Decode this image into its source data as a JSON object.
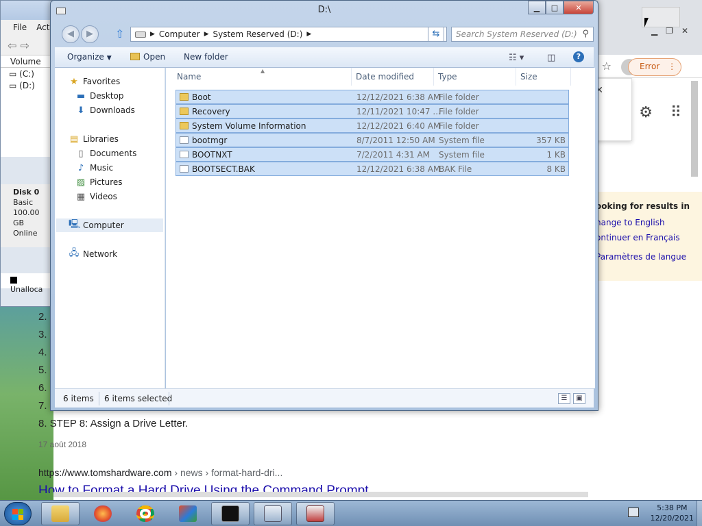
{
  "explorer": {
    "title": "D:\\",
    "breadcrumb": [
      "Computer",
      "System Reserved (D:)"
    ],
    "search_placeholder": "Search System Reserved (D:)",
    "toolbar": {
      "organize": "Organize",
      "open": "Open",
      "new_folder": "New folder"
    },
    "nav": {
      "favorites": "Favorites",
      "desktop": "Desktop",
      "downloads": "Downloads",
      "libraries": "Libraries",
      "documents": "Documents",
      "music": "Music",
      "pictures": "Pictures",
      "videos": "Videos",
      "computer": "Computer",
      "network": "Network"
    },
    "columns": {
      "name": "Name",
      "date": "Date modified",
      "type": "Type",
      "size": "Size"
    },
    "files": [
      {
        "name": "Boot",
        "date": "12/12/2021 6:38 AM",
        "type": "File folder",
        "size": "",
        "icon": "folder-icon"
      },
      {
        "name": "Recovery",
        "date": "12/11/2021 10:47 ...",
        "type": "File folder",
        "size": "",
        "icon": "folder-icon"
      },
      {
        "name": "System Volume Information",
        "date": "12/12/2021 6:40 AM",
        "type": "File folder",
        "size": "",
        "icon": "folder-icon"
      },
      {
        "name": "bootmgr",
        "date": "8/7/2011 12:50 AM",
        "type": "System file",
        "size": "357 KB",
        "icon": "system-file-icon"
      },
      {
        "name": "BOOTNXT",
        "date": "7/2/2011 4:31 AM",
        "type": "System file",
        "size": "1 KB",
        "icon": "system-file-icon"
      },
      {
        "name": "BOOTSECT.BAK",
        "date": "12/12/2021 6:38 AM",
        "type": "BAK File",
        "size": "8 KB",
        "icon": "file-icon"
      }
    ],
    "status": {
      "count": "6 items",
      "selected": "6 items selected"
    }
  },
  "disk_mgmt": {
    "menu": [
      "File",
      "Acti"
    ],
    "volume_header": "Volume",
    "volumes": [
      "(C:)",
      "(D:)"
    ],
    "disk_label": "Disk 0",
    "disk_type": "Basic",
    "disk_size": "100.00 GB",
    "disk_status": "Online",
    "unallocated": "Unalloca"
  },
  "browser": {
    "error_label": "Error",
    "language_notice": {
      "heading": "ooking for results in",
      "links": [
        "hange to English",
        "ontinuer en Français",
        "Paramètres de langue"
      ]
    },
    "steps": [
      "2.",
      "3.",
      "4.",
      "5.",
      "6.",
      "7.",
      "8. STEP 8: Assign a Drive Letter."
    ],
    "date": "17 août 2018",
    "result_url": "https://www.tomshardware.com",
    "result_path": " › news › format-hard-dri...",
    "result_title": "How to Format a Hard Drive Using the Command Prompt"
  },
  "taskbar": {
    "time": "5:38 PM",
    "date": "12/20/2021",
    "apps": [
      "file-explorer",
      "firefox",
      "chrome",
      "office",
      "command-prompt",
      "control-panel",
      "disk-management"
    ]
  }
}
